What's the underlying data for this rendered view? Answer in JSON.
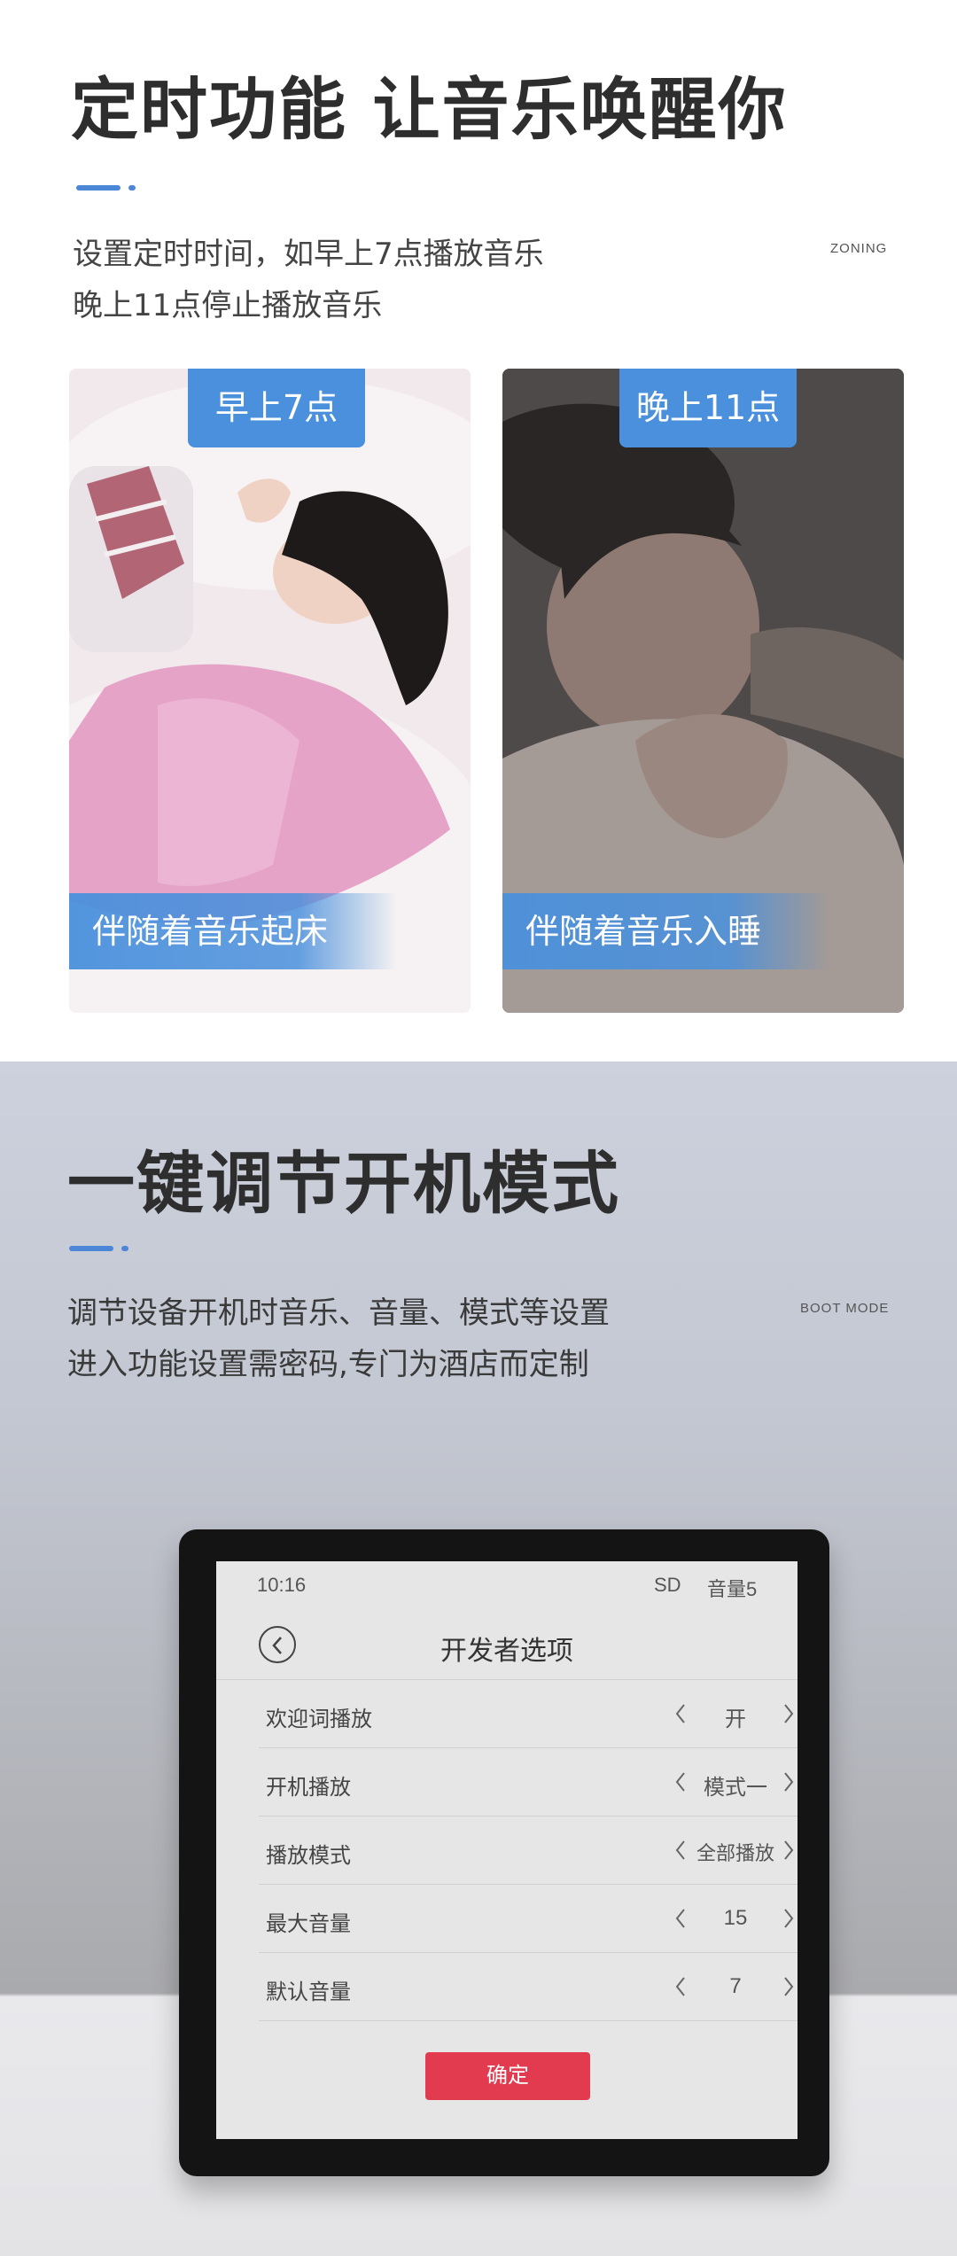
{
  "section_timer": {
    "title": "定时功能 让音乐唤醒你",
    "desc_line1": "设置定时时间，如早上7点播放音乐",
    "desc_line2": "晚上11点停止播放音乐",
    "tagline": "ZONING",
    "cards": [
      {
        "tag": "早上7点",
        "caption": "伴随着音乐起床"
      },
      {
        "tag": "晚上11点",
        "caption": "伴随着音乐入睡"
      }
    ]
  },
  "section_boot": {
    "title": "一键调节开机模式",
    "desc_line1": "调节设备开机时音乐、音量、模式等设置",
    "desc_line2": "进入功能设置需密码,专门为酒店而定制",
    "tagline": "BOOT MODE"
  },
  "device_screen": {
    "status": {
      "time": "10:16",
      "sd": "SD",
      "volume": "音量5"
    },
    "header_title": "开发者选项",
    "rows": [
      {
        "label": "欢迎词播放",
        "value": "开"
      },
      {
        "label": "开机播放",
        "value": "模式一"
      },
      {
        "label": "播放模式",
        "value": "全部播放"
      },
      {
        "label": "最大音量",
        "value": "15"
      },
      {
        "label": "默认音量",
        "value": "7"
      }
    ],
    "confirm_label": "确定"
  },
  "colors": {
    "accent": "#4a90dc",
    "confirm": "#e23b4f",
    "title_text": "#2e2e2e"
  }
}
